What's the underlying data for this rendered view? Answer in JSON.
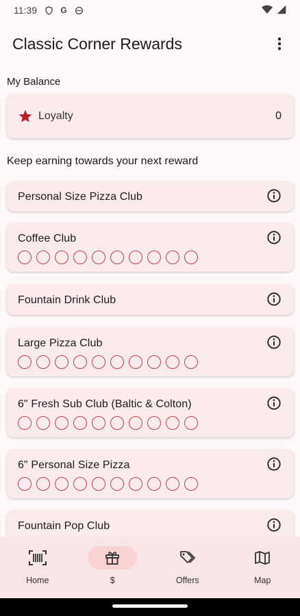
{
  "status": {
    "time": "11:39"
  },
  "app": {
    "title": "Classic Corner Rewards"
  },
  "balance": {
    "section": "My Balance",
    "label": "Loyalty",
    "value": "0"
  },
  "earning": {
    "section": "Keep earning towards your next reward"
  },
  "clubs": [
    {
      "name": "Personal Size Pizza Club",
      "stamps": 0
    },
    {
      "name": "Coffee Club",
      "stamps": 10
    },
    {
      "name": "Fountain Drink Club",
      "stamps": 0
    },
    {
      "name": "Large Pizza Club",
      "stamps": 10
    },
    {
      "name": "6\" Fresh Sub Club (Baltic & Colton)",
      "stamps": 10
    },
    {
      "name": "6\" Personal Size Pizza",
      "stamps": 10
    },
    {
      "name": "Fountain Pop Club",
      "stamps": 0
    }
  ],
  "nav": [
    {
      "label": "Home",
      "icon": "barcode-scan-icon",
      "active": false
    },
    {
      "label": "$",
      "icon": "gift-icon",
      "active": true
    },
    {
      "label": "Offers",
      "icon": "tag-icon",
      "active": false
    },
    {
      "label": "Map",
      "icon": "map-icon",
      "active": false
    }
  ],
  "colors": {
    "accent": "#c0404a",
    "card": "#fbebed",
    "nav_active": "#fbd2d4",
    "star": "#b7202e"
  }
}
